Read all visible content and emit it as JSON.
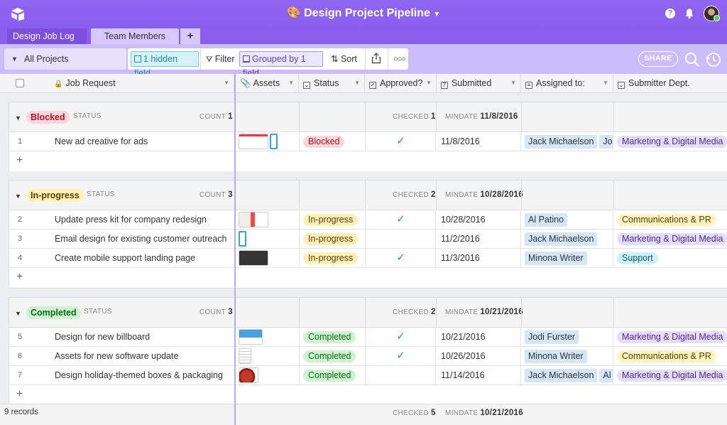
{
  "app": {
    "base_title": "Design Project Pipeline",
    "base_emoji": "🎨",
    "help_label": "?",
    "accent": "#8a5fee"
  },
  "tabs": [
    {
      "label": "Design Job Log",
      "active": true
    },
    {
      "label": "Team Members",
      "active": false
    },
    {
      "label": "+",
      "active": false
    }
  ],
  "toolbar": {
    "view_name": "All Projects",
    "hidden_fields": "1 hidden field",
    "filter": "Filter",
    "grouped": "Grouped by 1 field",
    "sort": "Sort",
    "share": "SHARE"
  },
  "columns": [
    "Job Request",
    "Assets",
    "Status",
    "Approved?",
    "Submitted",
    "Assigned to:",
    "Submitter Dept."
  ],
  "groups": [
    {
      "label": "Blocked",
      "field": "STATUS",
      "count_label": "COUNT",
      "count": "1",
      "checked_label": "CHECKED",
      "checked": "1",
      "mindate_label": "MINDATE",
      "mindate": "11/8/2016",
      "pill_bg": "#fbd6dc",
      "pill_fg": "#b4141e",
      "rows": [
        {
          "n": "1",
          "job": "New ad creative for ads",
          "status": "Blocked",
          "approved": "✓",
          "submitted": "11/8/2016",
          "assigned": [
            "Jack Michaelson",
            "Jodi F"
          ],
          "dept": "Marketing & Digital Media",
          "dept_key": "mdm"
        }
      ]
    },
    {
      "label": "In-progress",
      "field": "STATUS",
      "count_label": "COUNT",
      "count": "3",
      "checked_label": "CHECKED",
      "checked": "2",
      "mindate_label": "MINDATE",
      "mindate": "10/28/2016",
      "pill_bg": "#fff0b8",
      "pill_fg": "#5a3e00",
      "rows": [
        {
          "n": "2",
          "job": "Update press kit for company redesign",
          "status": "In-progress",
          "approved": "✓",
          "submitted": "10/28/2016",
          "assigned": [
            "Al Patino"
          ],
          "dept": "Communications & PR",
          "dept_key": "cpr"
        },
        {
          "n": "3",
          "job": "Email design for existing customer outreach",
          "status": "In-progress",
          "approved": "",
          "submitted": "11/2/2016",
          "assigned": [
            "Jack Michaelson"
          ],
          "dept": "Marketing & Digital Media",
          "dept_key": "mdm"
        },
        {
          "n": "4",
          "job": "Create mobile support landing page",
          "status": "In-progress",
          "approved": "✓",
          "submitted": "11/3/2016",
          "assigned": [
            "Minona Writer"
          ],
          "dept": "Support",
          "dept_key": "sup"
        }
      ]
    },
    {
      "label": "Completed",
      "field": "STATUS",
      "count_label": "COUNT",
      "count": "3",
      "checked_label": "CHECKED",
      "checked": "2",
      "mindate_label": "MINDATE",
      "mindate": "10/21/2016",
      "pill_bg": "#d0f2d0",
      "pill_fg": "#0a6b1a",
      "rows": [
        {
          "n": "5",
          "job": "Design for new billboard",
          "status": "Completed",
          "approved": "✓",
          "submitted": "10/21/2016",
          "assigned": [
            "Jodi Furster"
          ],
          "dept": "Marketing & Digital Media",
          "dept_key": "mdm"
        },
        {
          "n": "6",
          "job": "Assets for new software update",
          "status": "Completed",
          "approved": "✓",
          "submitted": "10/26/2016",
          "assigned": [
            "Minona Writer"
          ],
          "dept": "Communications & PR",
          "dept_key": "cpr"
        },
        {
          "n": "7",
          "job": "Design holiday-themed boxes & packaging",
          "status": "Completed",
          "approved": "",
          "submitted": "11/14/2016",
          "assigned": [
            "Jack Michaelson",
            "Al Pa"
          ],
          "dept": "Marketing & Digital Media",
          "dept_key": "mdm"
        }
      ]
    }
  ],
  "dept_colors": {
    "mdm": {
      "bg": "#e6dcfb",
      "fg": "#4a2d99"
    },
    "cpr": {
      "bg": "#fff3c2",
      "fg": "#5a3e00"
    },
    "sup": {
      "bg": "#cdf1f8",
      "fg": "#0b5c70"
    }
  },
  "footer": {
    "records": "9 records",
    "checked_label": "CHECKED",
    "checked": "5",
    "mindate_label": "MINDATE",
    "mindate": "10/21/2016"
  }
}
